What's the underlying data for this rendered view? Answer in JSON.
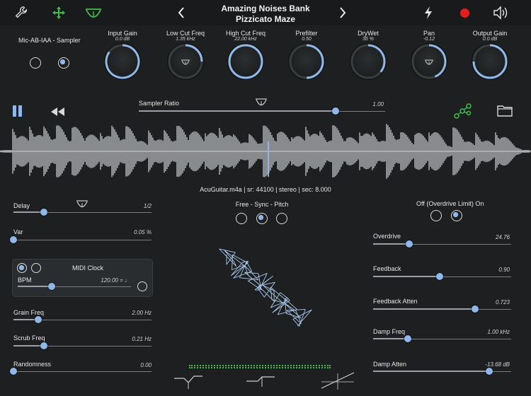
{
  "header": {
    "title": "Amazing Noises Bank",
    "subtitle": "Pizzicato Maze",
    "icons": [
      "wrench-icon",
      "move-arrows-icon",
      "scale-icon",
      "chevron-left-icon",
      "chevron-right-icon",
      "lightning-icon",
      "record-icon",
      "speaker-icon"
    ]
  },
  "input_mode": {
    "label": "Mic-AB-IAA - Sampler",
    "options": 2,
    "selected": 1
  },
  "knobs": [
    {
      "label": "Input Gain",
      "value": "0.0 dB",
      "level": 0.85
    },
    {
      "label": "Low Cut Freq",
      "value": "1.35 kHz",
      "level": 0.25
    },
    {
      "label": "High Cut Freq",
      "value": "22.00 kHz",
      "level": 1.0
    },
    {
      "label": "Prefilter",
      "value": "0.50",
      "level": 0.5
    },
    {
      "label": "DryWet",
      "value": "36 %",
      "level": 0.36
    },
    {
      "label": "Pan",
      "value": "-0.12",
      "level": 0.44
    },
    {
      "label": "Output Gain",
      "value": "0.0 dB",
      "level": 0.75
    }
  ],
  "transport": {
    "sampler_ratio_label": "Sampler Ratio",
    "sampler_ratio_value": "1.00",
    "sampler_ratio_level": 0.8
  },
  "waveform_info": "AcuGuitar.m4a | sr: 44100 | stereo | sec: 8.000",
  "left_params": {
    "delay": {
      "label": "Delay",
      "value": "1/2",
      "level": 0.22
    },
    "var": {
      "label": "Var",
      "value": "0.05 %",
      "level": 0.0
    },
    "midi_clock": {
      "label": "MIDI Clock",
      "bpm_label": "BPM",
      "bpm_value": "120.00 = ♩",
      "bpm_level": 0.3
    },
    "grain_freq": {
      "label": "Grain Freq",
      "value": "2.00 Hz",
      "level": 0.18
    },
    "scrub_freq": {
      "label": "Scrub Freq",
      "value": "0.21 Hz",
      "level": 0.22
    },
    "randomness": {
      "label": "Randomness",
      "value": "0.00",
      "level": 0.0
    }
  },
  "center": {
    "mode_label": "Free - Sync - Pitch",
    "mode_selected": 1,
    "overdrive_label": "Off (Overdrive Limit) On",
    "overdrive_selected": 1
  },
  "right_params": {
    "overdrive": {
      "label": "Overdrive",
      "value": "24.76",
      "level": 0.26
    },
    "feedback": {
      "label": "Feedback",
      "value": "0.90",
      "level": 0.48
    },
    "feedback_atten": {
      "label": "Feedback Atten",
      "value": "0.723",
      "level": 0.74
    },
    "damp_freq": {
      "label": "Damp Freq",
      "value": "1.00 kHz",
      "level": 0.25
    },
    "damp_atten": {
      "label": "Damp Atten",
      "value": "-13.68 dB",
      "level": 0.84
    }
  },
  "colors": {
    "accent": "#8fb8e8",
    "green": "#3fbf4a",
    "record": "#e0201e",
    "waveform": "#cfd3d6"
  }
}
